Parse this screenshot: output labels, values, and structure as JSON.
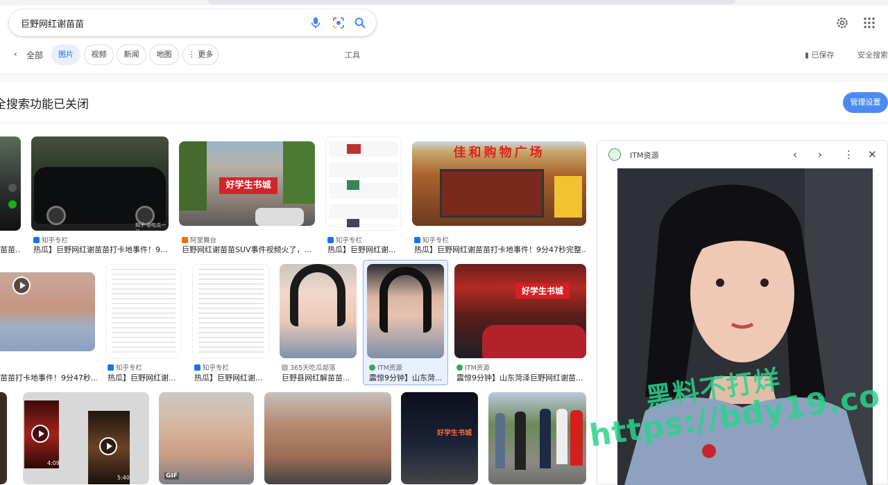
{
  "search": {
    "query": "巨野网红谢苗苗"
  },
  "tabs": {
    "all": "全部",
    "items": [
      "图片",
      "视频",
      "新闻",
      "地图",
      "更多"
    ],
    "tools": "工具",
    "saved": "已保存",
    "safesearch": "安全搜索"
  },
  "notice": {
    "text": "全搜索功能已关闭",
    "manage_label": "管理设置"
  },
  "results": {
    "row1": [
      {
        "source": "",
        "title": "苗苗..."
      },
      {
        "source": "知乎专栏",
        "title": "热瓜】巨野网红谢苗苗打卡地事件！9..."
      },
      {
        "source": "阿里舞台",
        "title": "巨野网红谢苗苗SUV事件视频火了，..."
      },
      {
        "source": "知乎专栏",
        "title": "热瓜】巨野网红谢..."
      },
      {
        "source": "知乎专栏",
        "title": "热瓜】巨野网红谢苗苗打卡地事件！9分47秒完整..."
      }
    ],
    "row2": [
      {
        "source": "",
        "title": "苗苗打卡地事件！9分47秒..."
      },
      {
        "source": "知乎专栏",
        "title": "热瓜】巨野网红谢..."
      },
      {
        "source": "知乎专栏",
        "title": "热瓜】巨野网红谢..."
      },
      {
        "source": "365天吃瓜部落",
        "title": "巨野县网红解苗苗..."
      },
      {
        "source": "ITM资源",
        "title": "震惊9分钟】山东菏..."
      },
      {
        "source": "ITM资源",
        "title": "震惊9分钟】山东菏泽巨野网红谢苗..."
      }
    ],
    "row3_durations": [
      "4:09",
      "5:40"
    ],
    "gif_label": "GIF"
  },
  "thumb_text": {
    "store_sign": "好学生书城",
    "mall_sign": "佳和购物广场",
    "zhihu_tag": "知乎 @吃瓜一号"
  },
  "preview": {
    "source": "ITM资源"
  },
  "watermark": {
    "line1": "黑料不打烊",
    "line2": "https://bdy19.co"
  },
  "colors": {
    "accent": "#1a73e8",
    "manage_btn": "#4b8bf1",
    "watermark": "#2bd38f"
  }
}
